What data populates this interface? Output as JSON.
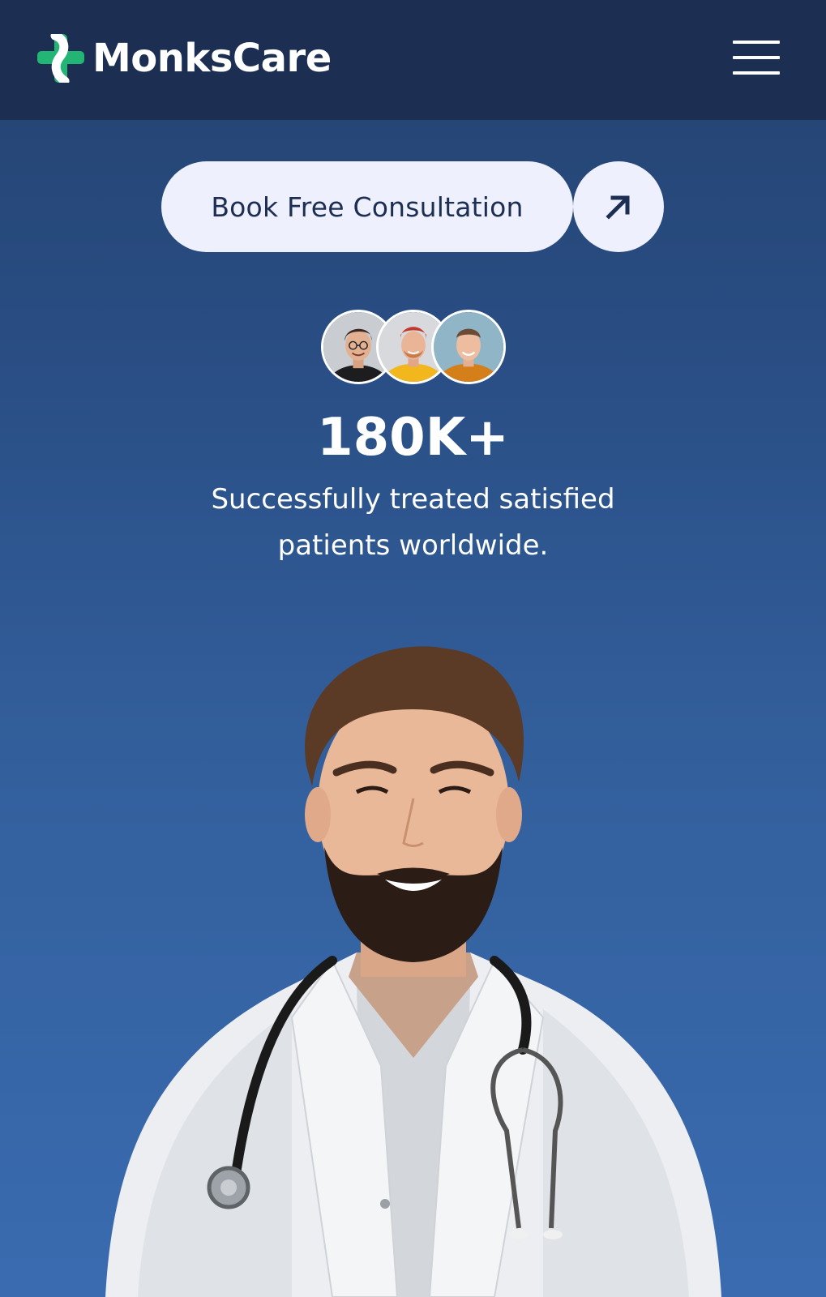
{
  "header": {
    "brand": "MonksCare",
    "logo_icon": "medical-cross-logo",
    "menu_icon": "hamburger-menu-icon",
    "background": "#1c2e52"
  },
  "hero": {
    "cta_label": "Book Free Consultation",
    "cta_icon": "arrow-up-right-icon",
    "stat_value": "180K+",
    "stat_line1": "Successfully treated satisfied",
    "stat_line2": "patients worldwide.",
    "avatars": [
      "patient-avatar-1",
      "patient-avatar-2",
      "patient-avatar-3"
    ],
    "hero_image": "doctor-portrait"
  },
  "colors": {
    "accent_green": "#22b573",
    "cta_background": "#eef0fd",
    "text_dark": "#1c2e52",
    "page_gradient_top": "#23426f",
    "page_gradient_bottom": "#3a6bb0"
  }
}
